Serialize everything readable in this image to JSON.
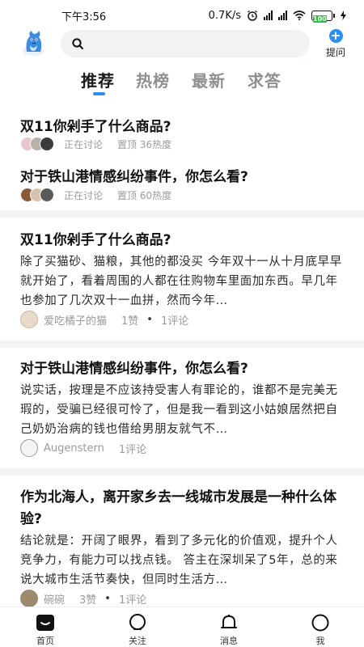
{
  "status_bar": {
    "time": "下午3:56",
    "net_speed": "0.7K/s",
    "battery": "100"
  },
  "header": {
    "search_placeholder": "",
    "ask_label": "提问"
  },
  "tabs": [
    {
      "label": "推荐",
      "active": true
    },
    {
      "label": "热榜",
      "active": false
    },
    {
      "label": "最新",
      "active": false
    },
    {
      "label": "求答",
      "active": false
    }
  ],
  "hot_topics": [
    {
      "title": "双11你剁手了什么商品?",
      "status": "正在讨论",
      "heat": "置顶 36热度"
    },
    {
      "title": "对于铁山港情感纠纷事件，你怎么看?",
      "status": "正在讨论",
      "heat": "置顶 60热度"
    }
  ],
  "feed": [
    {
      "title": "双11你剁手了什么商品?",
      "excerpt": "除了买猫砂、猫粮，其他的都没买 今年双十一从十月底早早就开始了，看着周围的人都在往购物车里面加东西。早几年也参加了几次双十一血拼，然而今年…",
      "author": "爱吃橘子的猫",
      "likes": "1赞",
      "comments": "1评论"
    },
    {
      "title": "对于铁山港情感纠纷事件，你怎么看?",
      "excerpt": "说实话，按理是不应该持受害人有罪论的，谁都不是完美无瑕的，受骗已经很可怜了，但是我一看到这小姑娘居然把自己奶奶治病的钱也借给男朋友就气不…",
      "author": "Augenstern",
      "likes": "",
      "comments": "1评论"
    },
    {
      "title": "作为北海人，离开家乡去一线城市发展是一种什么体验?",
      "excerpt": "结论就是：开阔了眼界，看到了多元化的价值观，提升个人竞争力，有能力可以找点钱。 答主在深圳呆了5年，总的来说大城市生活节奏快，但同时生活方…",
      "author": "碗碗",
      "likes": "3赞",
      "comments": "1评论"
    }
  ],
  "bottom_nav": [
    {
      "label": "首页",
      "icon": "home-icon"
    },
    {
      "label": "关注",
      "icon": "follow-icon"
    },
    {
      "label": "消息",
      "icon": "bell-icon"
    },
    {
      "label": "我",
      "icon": "profile-icon"
    }
  ],
  "colors": {
    "accent": "#2c8ef0",
    "muted_text": "#9a9a9a",
    "divider": "#f2f3f5"
  }
}
